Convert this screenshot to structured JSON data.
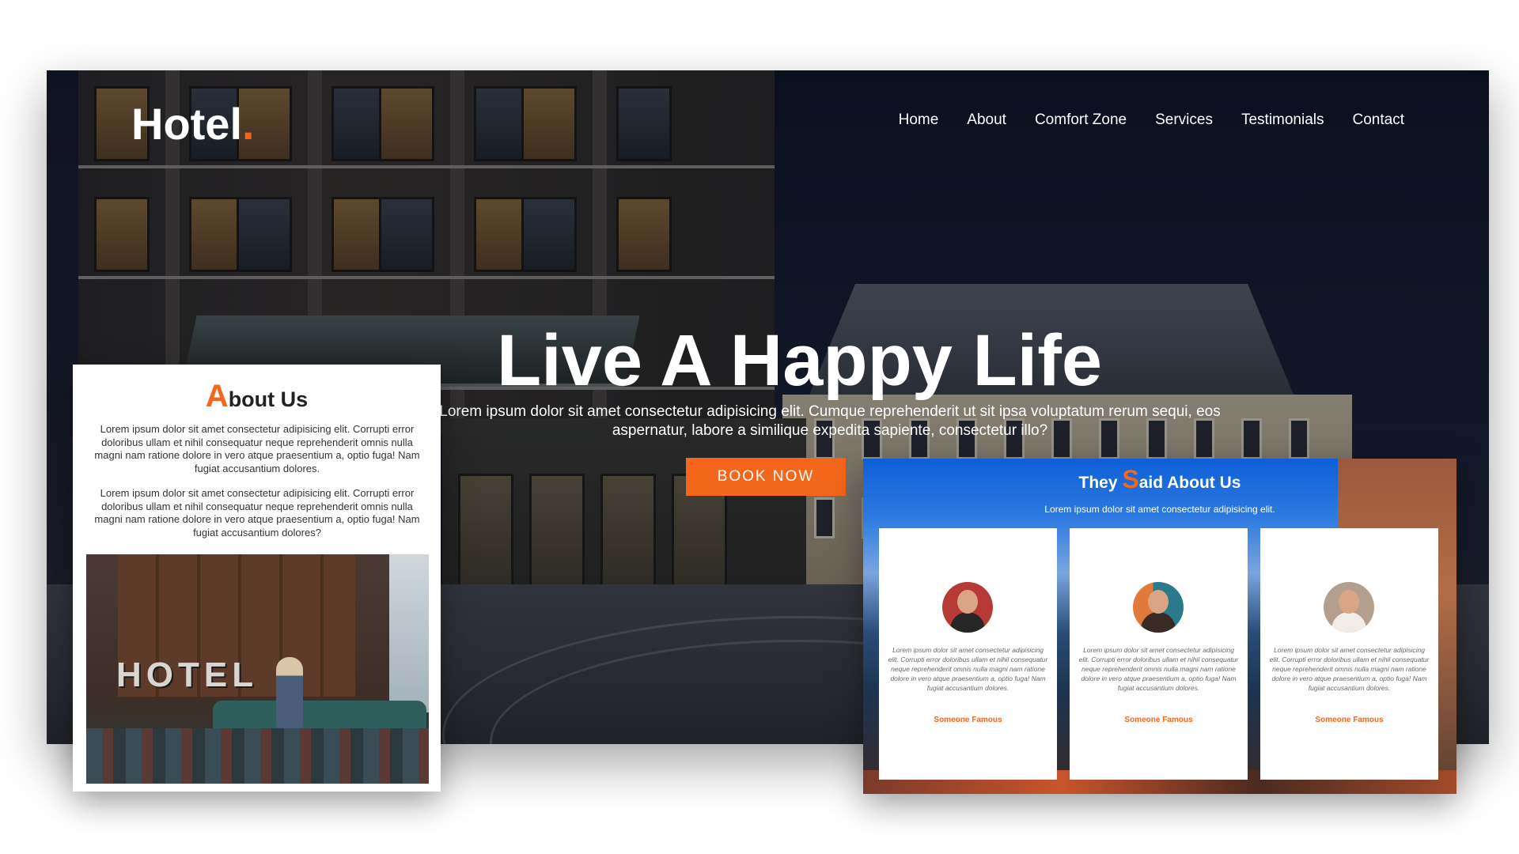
{
  "header": {
    "logo_text": "Hotel",
    "logo_dot": ".",
    "nav": [
      "Home",
      "About",
      "Comfort Zone",
      "Services",
      "Testimonials",
      "Contact"
    ]
  },
  "hero": {
    "title": "Live A Happy Life",
    "subtitle": "Lorem ipsum dolor sit amet consectetur adipisicing elit. Cumque reprehenderit ut sit ipsa voluptatum rerum sequi, eos aspernatur, labore a similique expedita sapiente, consectetur illo?",
    "button": "BOOK NOW"
  },
  "about": {
    "title_first": "A",
    "title_rest": "bout Us",
    "paragraphs": [
      "Lorem ipsum dolor sit amet consectetur adipisicing elit. Corrupti error doloribus ullam et nihil consequatur neque reprehenderit omnis nulla magni nam ratione dolore in vero atque praesentium a, optio fuga! Nam fugiat accusantium dolores.",
      "Lorem ipsum dolor sit amet consectetur adipisicing elit. Corrupti error doloribus ullam et nihil consequatur neque reprehenderit omnis nulla magni nam ratione dolore in vero atque praesentium a, optio fuga! Nam fugiat accusantium dolores?"
    ],
    "image_sign": "HOTEL"
  },
  "testimonials": {
    "title_prefix": "They ",
    "title_first": "S",
    "title_rest": "aid About Us",
    "subtitle": "Lorem ipsum dolor sit amet consectetur adipisicing elit.",
    "items": [
      {
        "text": "Lorem ipsum dolor sit amet consectetur adipisicing elit. Corrupti error doloribus ullam et nihil consequatur neque reprehenderit omnis nulla magni nam ratione dolore in vero atque praesentium a, optio fuga! Nam fugiat accusantium dolores.",
        "name": "Someone Famous"
      },
      {
        "text": "Lorem ipsum dolor sit amet consectetur adipisicing elit. Corrupti error doloribus ullam et nihil consequatur neque reprehenderit omnis nulla magni nam ratione dolore in vero atque praesentium a, optio fuga! Nam fugiat accusantium dolores.",
        "name": "Someone Famous"
      },
      {
        "text": "Lorem ipsum dolor sit amet consectetur adipisicing elit. Corrupti error doloribus ullam et nihil consequatur neque reprehenderit omnis nulla magni nam ratione dolore in vero atque praesentium a, optio fuga! Nam fugiat accusantium dolores.",
        "name": "Someone Famous"
      }
    ]
  },
  "colors": {
    "accent": "#f4661b",
    "text_dark": "#222222",
    "white": "#ffffff"
  }
}
